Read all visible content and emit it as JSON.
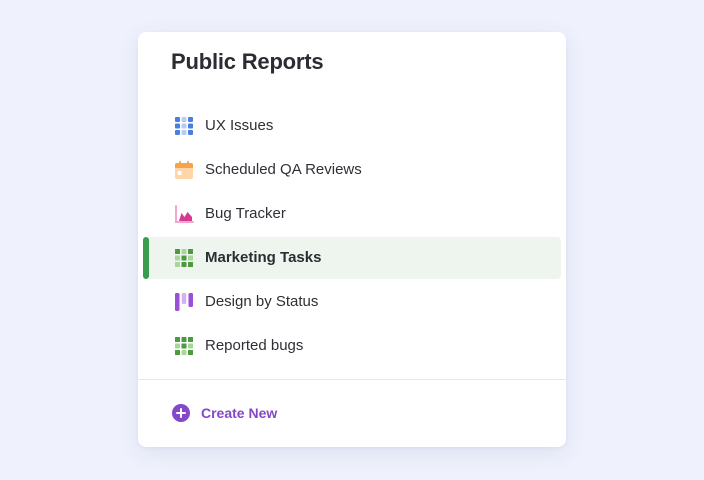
{
  "panel": {
    "title": "Public Reports",
    "items": [
      {
        "label": "UX Issues",
        "icon": "grid-icon",
        "icon_color": "#4a7fe0"
      },
      {
        "label": "Scheduled QA Reviews",
        "icon": "calendar-icon",
        "icon_color": "#f5a34d"
      },
      {
        "label": "Bug Tracker",
        "icon": "area-chart-icon",
        "icon_color": "#d6398f"
      },
      {
        "label": "Marketing Tasks",
        "icon": "grid-icon",
        "icon_color": "#4c9a3d"
      },
      {
        "label": "Design by Status",
        "icon": "kanban-icon",
        "icon_color": "#9b4fd6"
      },
      {
        "label": "Reported bugs",
        "icon": "grid-icon",
        "icon_color": "#4c9a3d"
      }
    ],
    "active_index": 3,
    "active_color": "#3a9d4e",
    "create_label": "Create New",
    "create_color": "#8448c9"
  }
}
